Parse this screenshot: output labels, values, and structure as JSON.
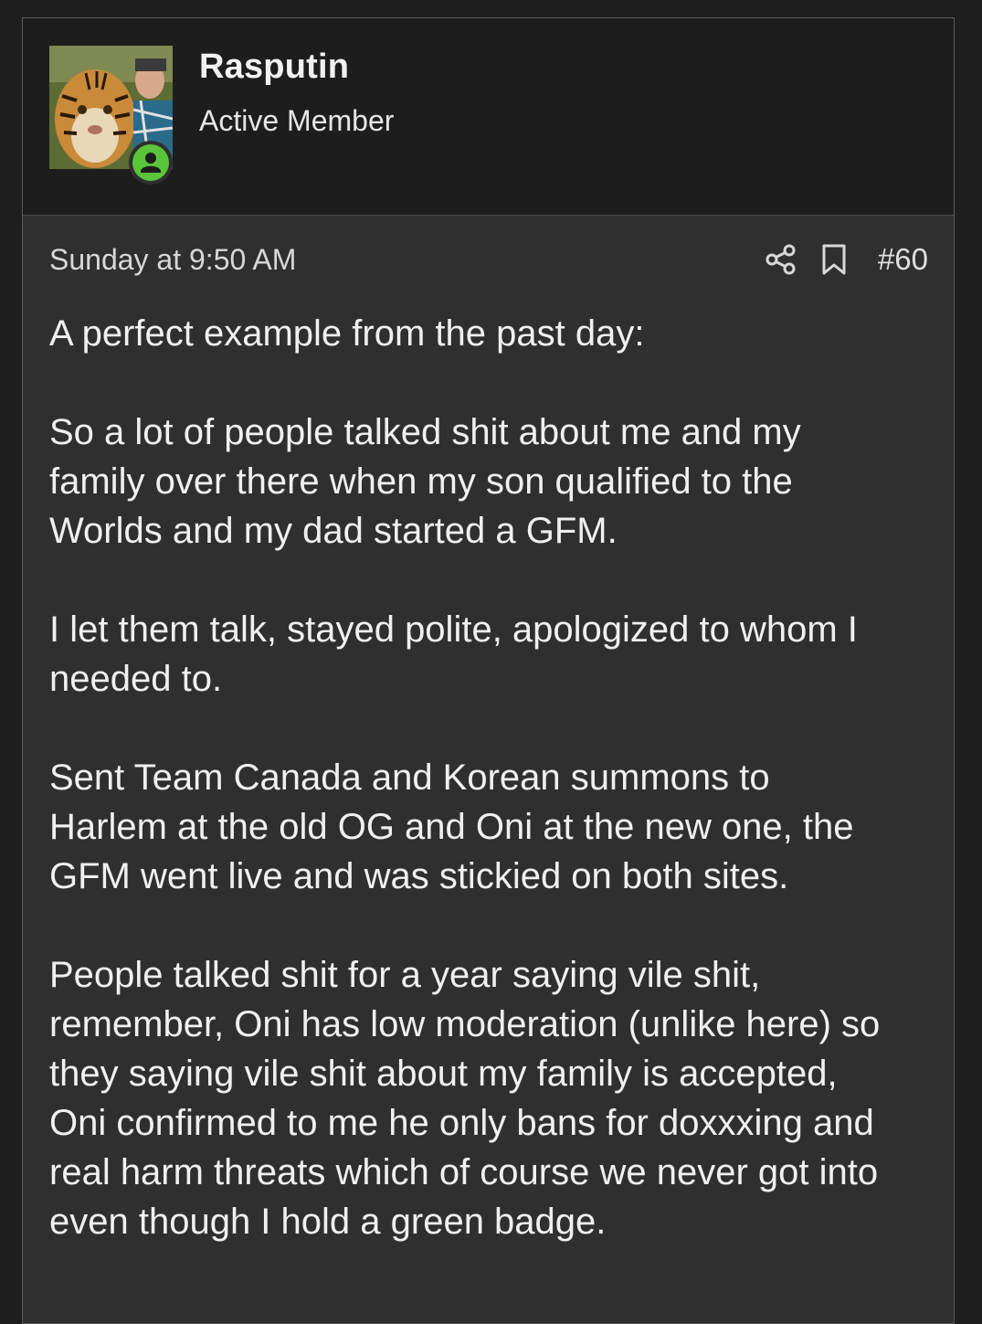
{
  "user": {
    "name": "Rasputin",
    "title": "Active Member"
  },
  "post": {
    "timestamp": "Sunday at 9:50 AM",
    "number": "#60",
    "paragraphs": [
      "A perfect example from the past day:",
      "So a lot of people talked shit about me and my\nfamily over there when my son qualified to the\nWorlds and my dad started a GFM.",
      "I let them talk, stayed polite, apologized to whom I\nneeded to.",
      "Sent Team Canada and Korean summons to\nHarlem at the old OG and Oni at the new one, the\nGFM went live and was stickied on both sites.",
      "People talked shit for a year saying vile shit,\nremember, Oni has low moderation (unlike here) so\nthey saying vile shit about my family is accepted,\nOni confirmed to me he only bans for doxxxing and\nreal harm threats which of course we never got into\neven though I hold a green badge."
    ]
  },
  "icons": {
    "share": "share-icon",
    "bookmark": "bookmark-icon",
    "online": "online-status-icon"
  },
  "colors": {
    "background": "#1e1e1e",
    "header_bg": "#1d1d1d",
    "post_bg": "#2f2f2f",
    "online_green": "#5ac43a"
  }
}
